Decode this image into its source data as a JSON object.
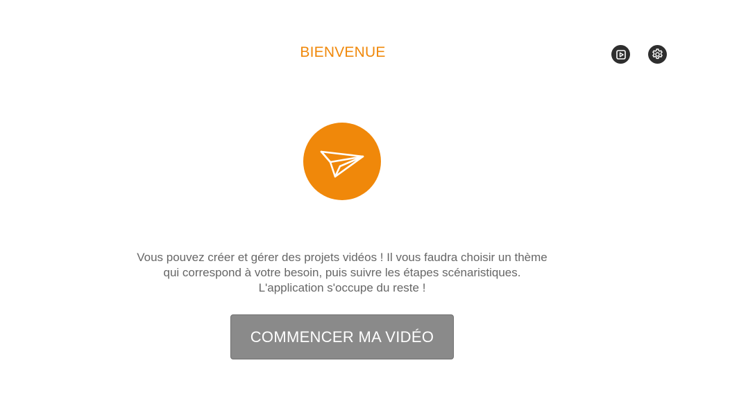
{
  "header": {
    "title": "BIENVENUE",
    "video_icon": "video-library-icon",
    "settings_icon": "gear-icon"
  },
  "hero": {
    "icon": "paper-plane-icon"
  },
  "main": {
    "description": "Vous pouvez créer et gérer des projets vidéos ! Il vous faudra choisir un thème qui correspond à votre besoin, puis suivre les étapes scénaristiques. L'application s'occupe du reste !",
    "start_button_label": "COMMENCER MA VIDÉO"
  },
  "colors": {
    "accent": "#F0880A",
    "button_bg": "#8a8a8a",
    "text_muted": "#666666",
    "icon_bg": "#2e2e2e"
  }
}
